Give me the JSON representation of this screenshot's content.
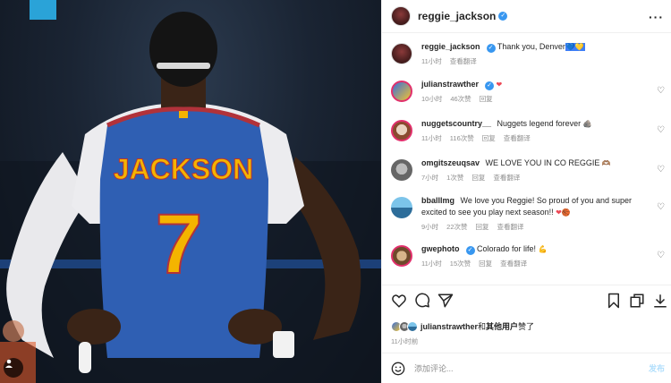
{
  "post": {
    "author": "reggie_jackson",
    "jersey_name": "JACKSON",
    "jersey_number": "7"
  },
  "comments": [
    {
      "user": "reggie_jackson",
      "text": "Thank you, Denver",
      "emoji": "💙💛",
      "time": "11小时",
      "likes": "",
      "reply": "",
      "translate": "查看翻译",
      "verified": true,
      "heart": false
    },
    {
      "user": "julianstrawther",
      "text": "",
      "emoji": "❤",
      "time": "10小时",
      "likes": "46次赞",
      "reply": "回复",
      "translate": "",
      "verified": true,
      "heart": true
    },
    {
      "user": "nuggetscountry__",
      "text": "Nuggets legend forever",
      "emoji": "🪨",
      "time": "11小时",
      "likes": "116次赞",
      "reply": "回复",
      "translate": "查看翻译",
      "verified": false,
      "heart": true
    },
    {
      "user": "omgitszeuqsav",
      "text": "WE LOVE YOU IN CO REGGIE",
      "emoji": "🫶🏽",
      "time": "7小时",
      "likes": "1次赞",
      "reply": "回复",
      "translate": "查看翻译",
      "verified": false,
      "heart": true
    },
    {
      "user": "bballlmg",
      "text": "We love you Reggie! So proud of you and super excited to see you play next season!!",
      "emoji": "❤🏀",
      "time": "9小时",
      "likes": "22次赞",
      "reply": "回复",
      "translate": "查看翻译",
      "verified": false,
      "heart": true
    },
    {
      "user": "gwephoto",
      "text": "Colorado for life!",
      "emoji": "💪",
      "time": "11小时",
      "likes": "15次赞",
      "reply": "回复",
      "translate": "查看翻译",
      "verified": true,
      "heart": true
    }
  ],
  "likes_summary": {
    "user": "julianstrawther",
    "connector": "和",
    "others": "其他用户",
    "suffix": "赞了"
  },
  "post_time": "11小时前",
  "add_comment": {
    "placeholder": "添加评论...",
    "post_label": "发布"
  },
  "colors": {
    "verified": "#3897f0",
    "heart_red": "#ed4956",
    "jersey_blue": "#2f5fb3",
    "jersey_gold": "#f4b400"
  },
  "icons": {
    "more": "more-icon",
    "like": "heart-icon",
    "comment": "comment-icon",
    "share": "share-icon",
    "save": "bookmark-icon",
    "copy": "copy-icon",
    "download": "download-icon",
    "emoji": "smiley-icon"
  }
}
